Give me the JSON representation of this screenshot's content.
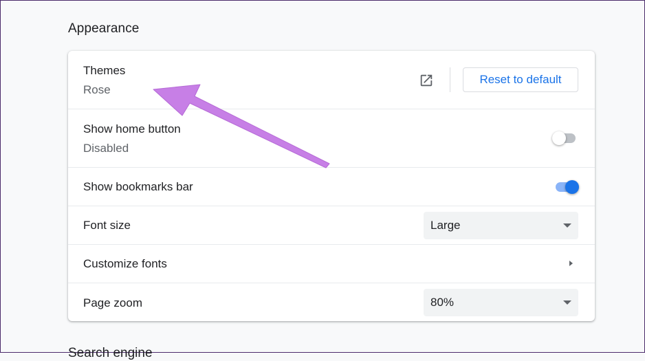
{
  "section": {
    "title": "Appearance",
    "next_title": "Search engine"
  },
  "themes": {
    "label": "Themes",
    "value": "Rose",
    "open_icon": "open-in-new-icon",
    "reset_label": "Reset to default"
  },
  "home_button": {
    "label": "Show home button",
    "value": "Disabled",
    "enabled": false
  },
  "bookmarks_bar": {
    "label": "Show bookmarks bar",
    "enabled": true
  },
  "font_size": {
    "label": "Font size",
    "selected": "Large"
  },
  "customize_fonts": {
    "label": "Customize fonts",
    "icon": "chevron-right-icon"
  },
  "page_zoom": {
    "label": "Page zoom",
    "selected": "80%"
  },
  "annotation": {
    "color": "#c77fe6",
    "icon": "pointer-arrow"
  },
  "colors": {
    "accent": "#1a73e8",
    "toggle_on_track": "#8ab4f8",
    "toggle_off_track": "#bdc1c6"
  }
}
